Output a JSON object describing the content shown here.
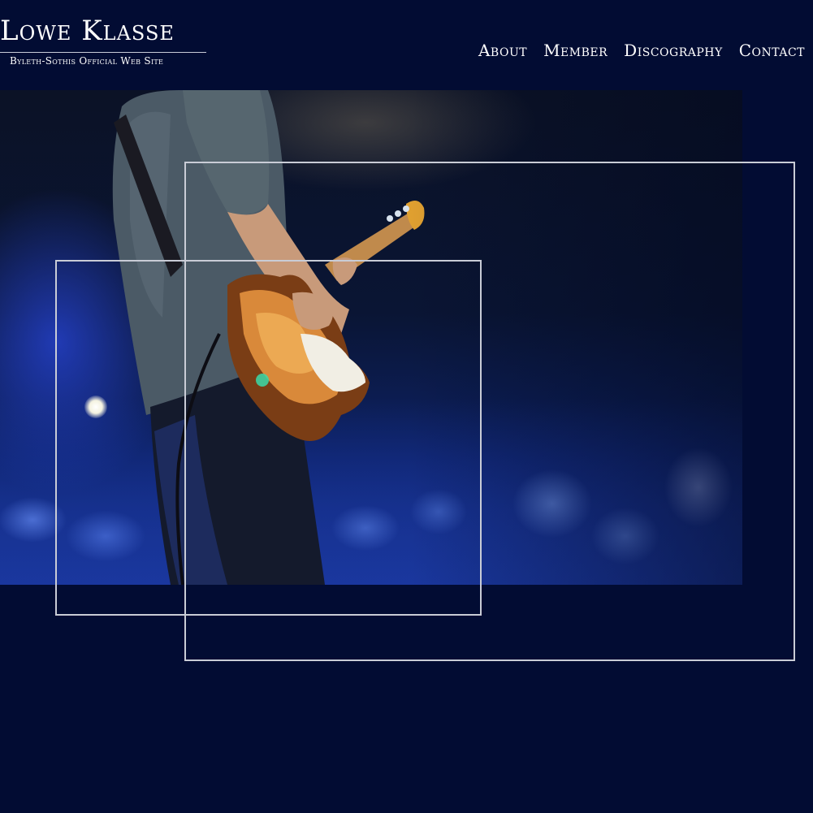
{
  "header": {
    "title": "Lowe Klasse",
    "subtitle": "Byleth-Sothis Official Web Site"
  },
  "nav": {
    "items": [
      {
        "label": "About"
      },
      {
        "label": "Member"
      },
      {
        "label": "Discography"
      },
      {
        "label": "Contact"
      }
    ]
  },
  "colors": {
    "background": "#020c33",
    "text": "#ffffff",
    "frame": "#c9ccd6"
  },
  "hero": {
    "image": "concert-guitarist-photo"
  }
}
